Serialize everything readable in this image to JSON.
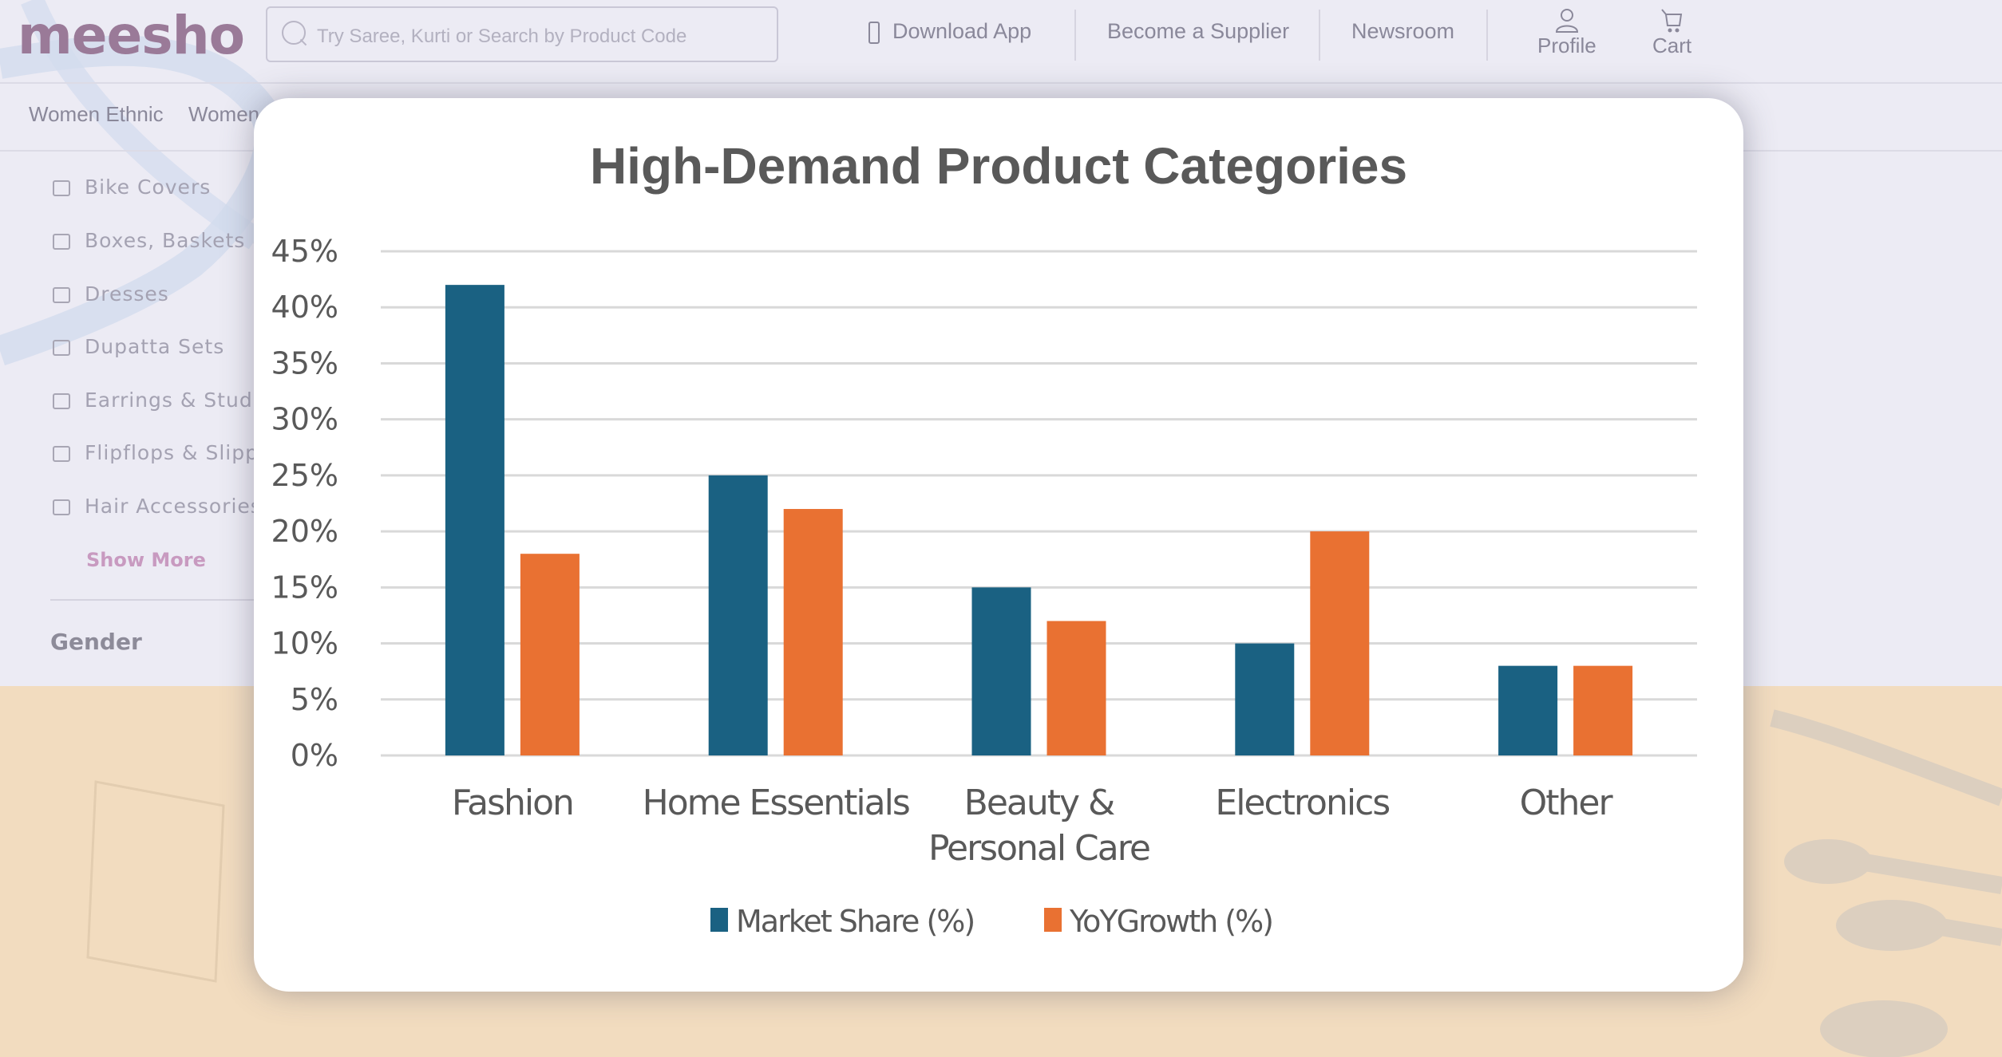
{
  "header": {
    "logo": "meesho",
    "search_placeholder": "Try Saree, Kurti or Search by Product Code",
    "download_app": "Download App",
    "become_supplier": "Become a Supplier",
    "newsroom": "Newsroom",
    "profile": "Profile",
    "cart": "Cart"
  },
  "category_nav": [
    "Women Ethnic",
    "Women Western"
  ],
  "sidebar": {
    "filters": [
      "Bike Covers",
      "Boxes, Baskets & Bins",
      "Dresses",
      "Dupatta Sets",
      "Earrings & Studs",
      "Flipflops & Slippers",
      "Hair Accessories"
    ],
    "show_more": "Show More",
    "gender_heading": "Gender"
  },
  "colors": {
    "market_share": "#1a6182",
    "yoy_growth": "#e97132",
    "grid": "#d9d9d9",
    "text": "#595959"
  },
  "chart_data": {
    "type": "bar",
    "title": "High-Demand Product Categories",
    "categories": [
      "Fashion",
      "Home Essentials",
      "Beauty & Personal Care",
      "Electronics",
      "Other"
    ],
    "category_lines": [
      [
        "Fashion"
      ],
      [
        "Home Essentials"
      ],
      [
        "Beauty &",
        "Personal Care"
      ],
      [
        "Electronics"
      ],
      [
        "Other"
      ]
    ],
    "series": [
      {
        "name": "Market Share (%)",
        "values": [
          42,
          25,
          15,
          10,
          8
        ]
      },
      {
        "name": "YoY Growth (%)",
        "values": [
          18,
          22,
          12,
          20,
          8
        ]
      }
    ],
    "legend_labels": [
      "Market Share (%)",
      "YoYGrowth (%)"
    ],
    "yticks": [
      "0%",
      "5%",
      "10%",
      "15%",
      "20%",
      "25%",
      "30%",
      "35%",
      "40%",
      "45%"
    ],
    "ylim": [
      0,
      45
    ],
    "xlabel": "",
    "ylabel": "",
    "grid": true,
    "legend_position": "bottom"
  }
}
